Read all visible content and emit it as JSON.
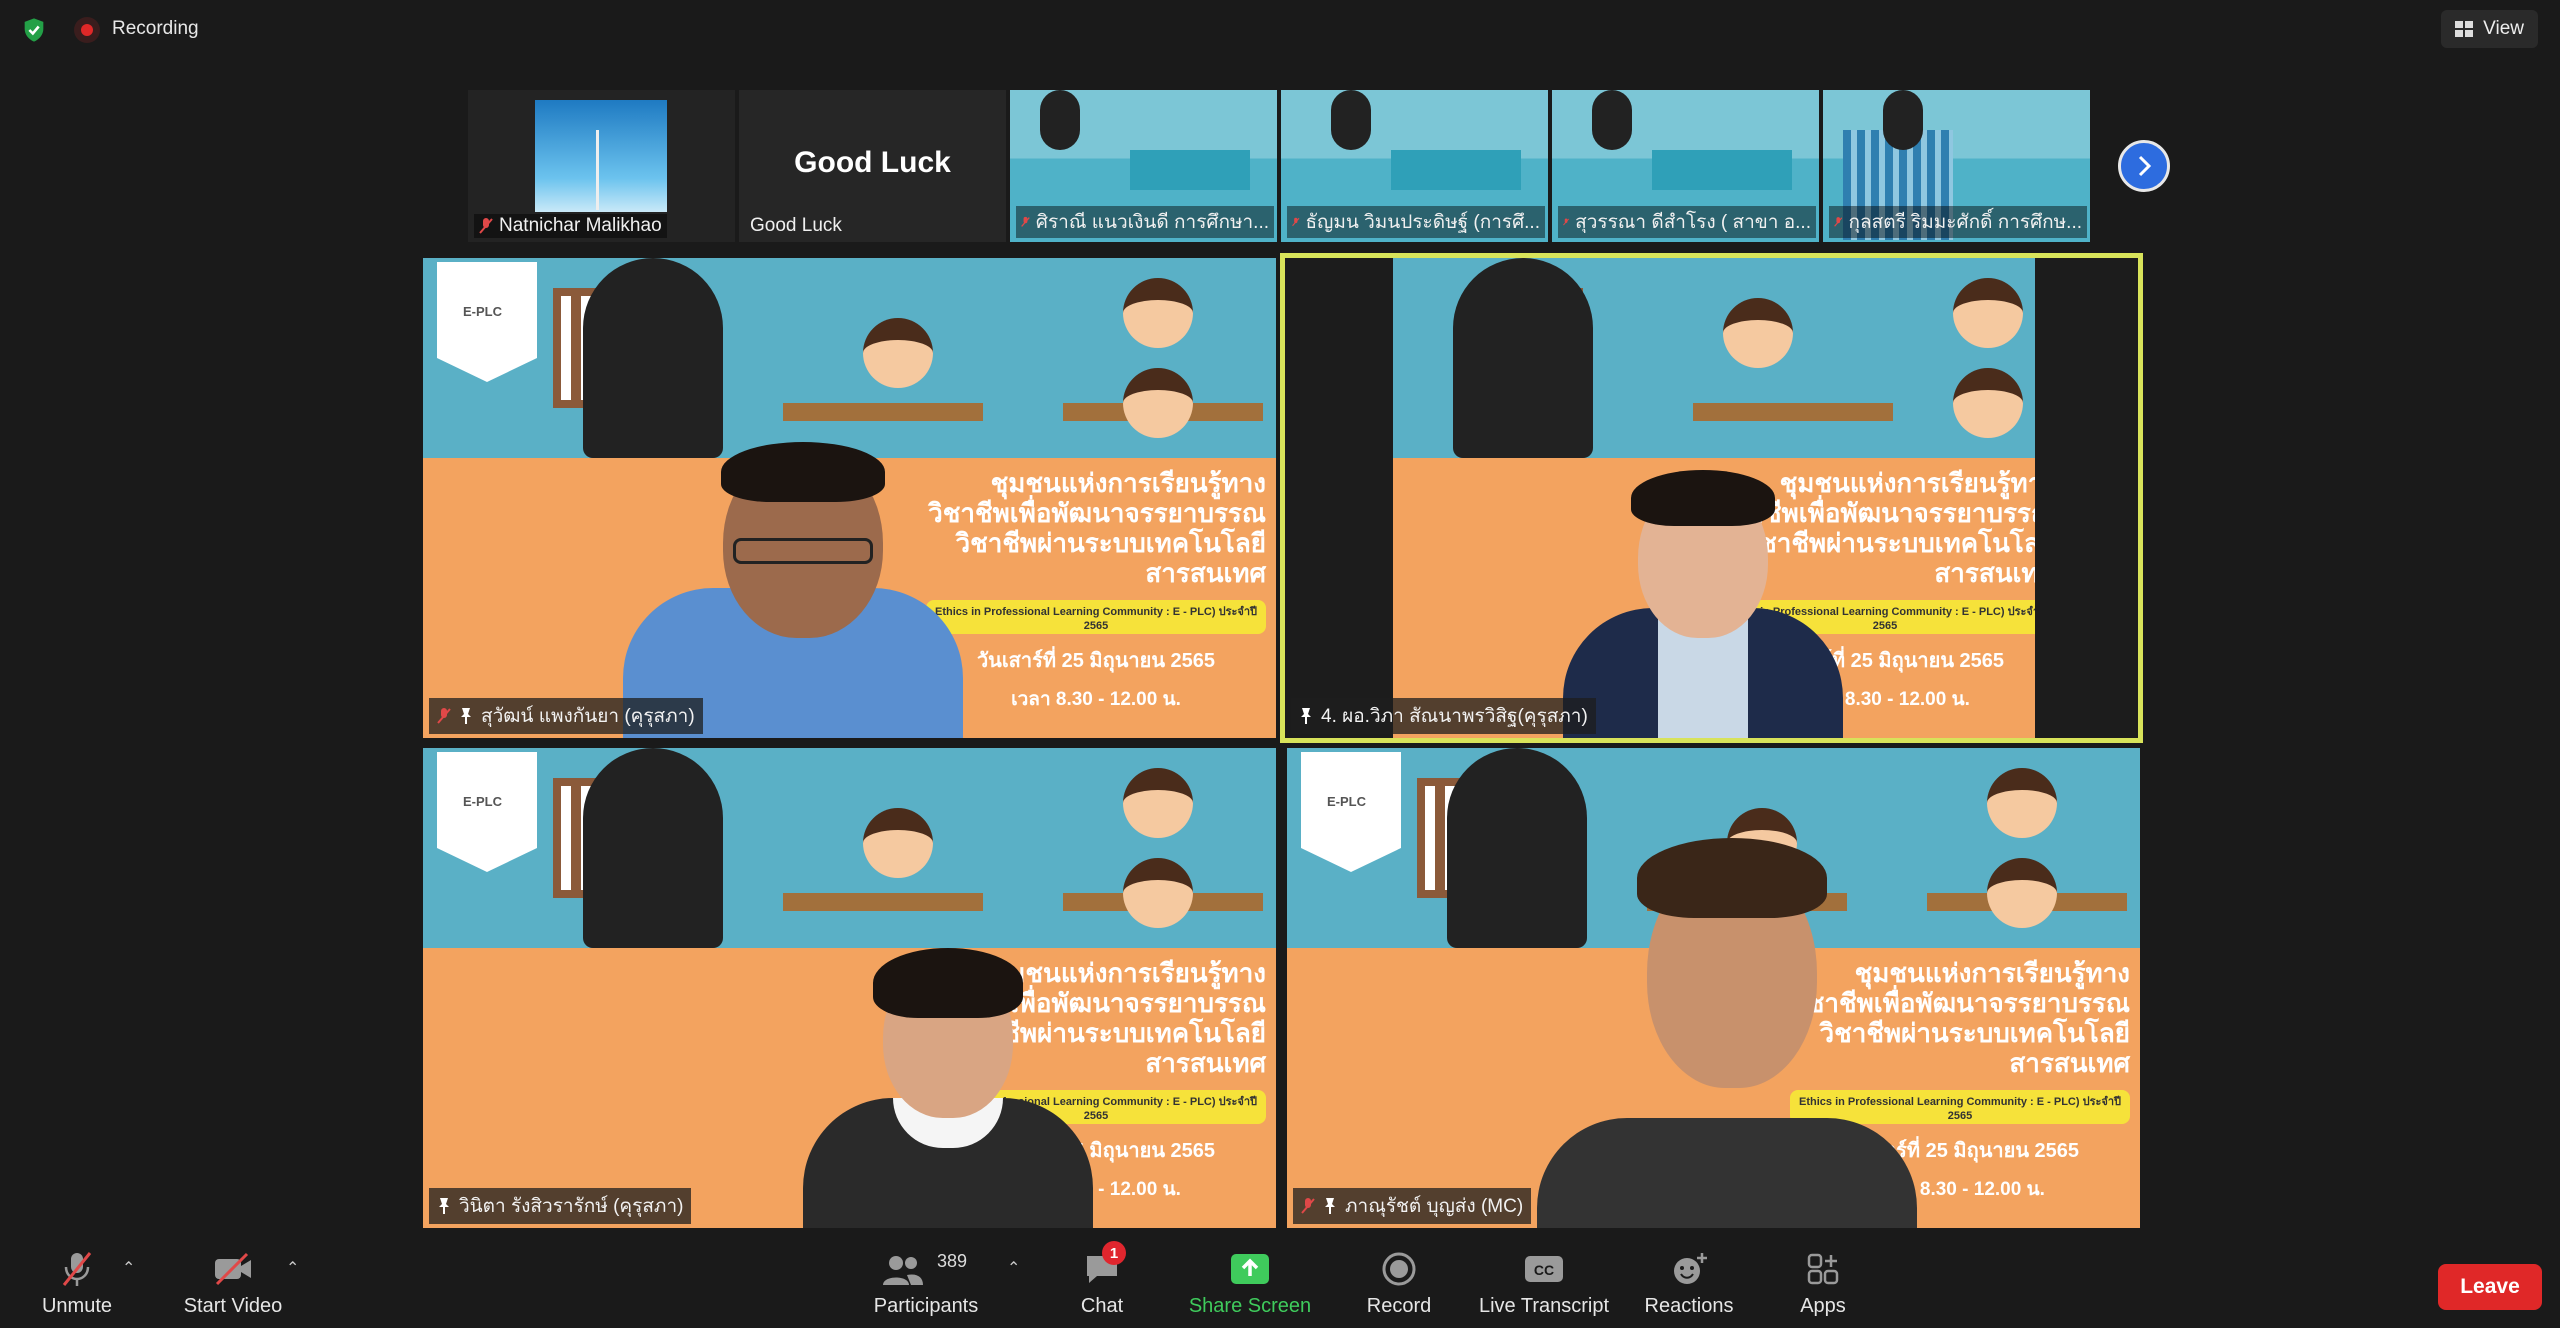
{
  "topbar": {
    "recording_label": "Recording",
    "view_label": "View"
  },
  "strip": {
    "thumbnails": [
      {
        "name": "Natnichar Malikhao",
        "muted": true,
        "kind": "image"
      },
      {
        "name": "Good Luck",
        "muted": false,
        "kind": "text",
        "big_text": "Good Luck"
      },
      {
        "name": "ศิราณี แนวเงินดี การศึกษา...",
        "muted": true,
        "kind": "scene"
      },
      {
        "name": "ธัญมน วิมนประดิษฐ์ (การศึ...",
        "muted": true,
        "kind": "scene"
      },
      {
        "name": "สุวรรณา ดีสำโรง ( สาขา อ...",
        "muted": true,
        "kind": "scene"
      },
      {
        "name": "กุลสตรี ริมมะศักดิ์ การศึกษ...",
        "muted": true,
        "kind": "scene"
      }
    ]
  },
  "banner": {
    "title": "ชุมชนแห่งการเรียนรู้ทางวิชาชีพเพื่อพัฒนาจรรยาบรรณวิชาชีพผ่านระบบเทคโนโลยีสารสนเทศ",
    "tag": "Ethics in Professional Learning Community : E - PLC) ประจำปี 2565",
    "date": "วันเสาร์ที่ 25 มิถุนายน 2565",
    "time": "เวลา 8.30 - 12.00 น."
  },
  "tiles": [
    {
      "name": "สุวัฒน์ แพงกันยา (คุรุสภา)",
      "muted": true,
      "pinned": true,
      "active": false
    },
    {
      "name": "4. ผอ.วิภา สัณนาพรวิสิฐ(คุรุสภา)",
      "muted": false,
      "pinned": true,
      "active": true
    },
    {
      "name": "วินิตา รังสิวรารักษ์ (คุรุสภา)",
      "muted": false,
      "pinned": true,
      "active": false
    },
    {
      "name": "ภาณุรัชต์ บุญส่ง (MC)",
      "muted": true,
      "pinned": true,
      "active": false
    }
  ],
  "toolbar": {
    "unmute": "Unmute",
    "start_video": "Start Video",
    "participants": "Participants",
    "participants_count": "389",
    "chat": "Chat",
    "chat_badge": "1",
    "share_screen": "Share Screen",
    "record": "Record",
    "live_transcript": "Live Transcript",
    "reactions": "Reactions",
    "apps": "Apps",
    "leave": "Leave"
  },
  "colors": {
    "accent_green": "#3fcb5c",
    "leave_red": "#e02828",
    "active_speaker": "#d8e35a",
    "next_blue": "#2d6cdf"
  }
}
